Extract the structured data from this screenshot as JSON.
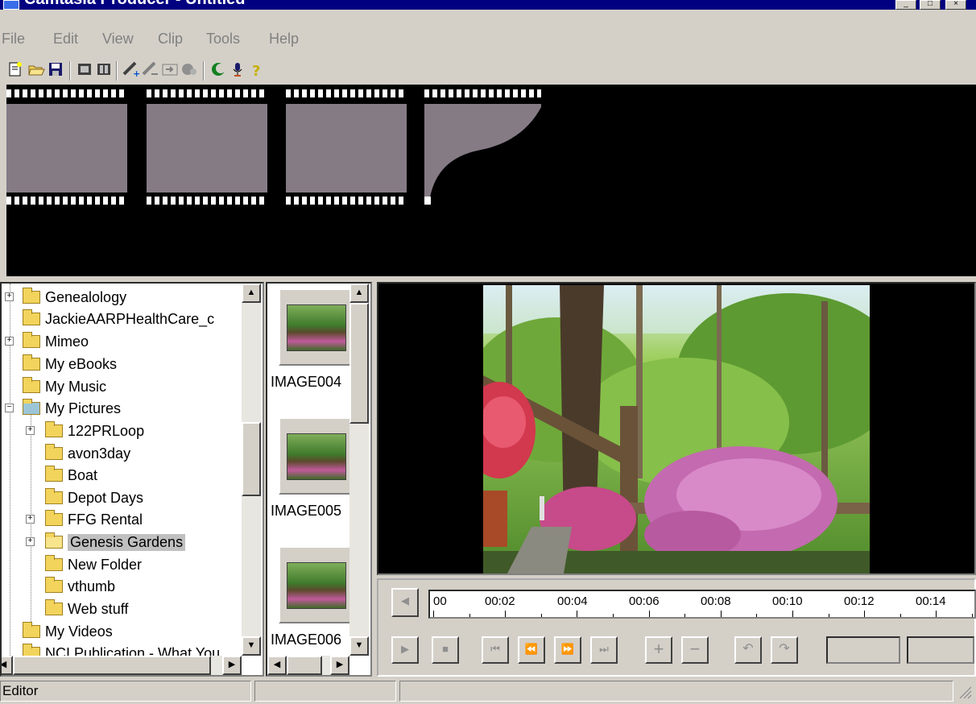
{
  "window": {
    "title": "Camtasia Producer - Untitled",
    "controls": [
      "_",
      "□",
      "×"
    ]
  },
  "menu": [
    {
      "label": "File"
    },
    {
      "label": "Edit"
    },
    {
      "label": "View"
    },
    {
      "label": "Clip"
    },
    {
      "label": "Tools"
    },
    {
      "label": "Help"
    }
  ],
  "toolbar": {
    "icons": [
      "new-file-icon",
      "open-folder-icon",
      "save-icon",
      "storyboard-icon",
      "timeline-icon",
      "add-clip-icon",
      "transition-icon",
      "title-clip-icon",
      "effects-icon",
      "record-icon",
      "microphone-icon",
      "help-icon"
    ]
  },
  "folder_tree": {
    "items": [
      {
        "label": "Genealology",
        "expander": "+"
      },
      {
        "label": "JackieAARPHealthCare_c"
      },
      {
        "label": "Mimeo",
        "expander": "+"
      },
      {
        "label": "My eBooks"
      },
      {
        "label": "My Music"
      },
      {
        "label": "My Pictures",
        "expander": "−"
      },
      {
        "label": "122PRLoop",
        "expander": "+"
      },
      {
        "label": "avon3day"
      },
      {
        "label": "Boat"
      },
      {
        "label": "Depot Days"
      },
      {
        "label": "FFG Rental",
        "expander": "+"
      },
      {
        "label": "Genesis Gardens",
        "expander": "+",
        "selected": true
      },
      {
        "label": "New Folder"
      },
      {
        "label": "vthumb"
      },
      {
        "label": "Web stuff"
      },
      {
        "label": "My Videos"
      },
      {
        "label": "NCI Publication - What You"
      }
    ]
  },
  "thumbnails": [
    {
      "label": "IMAGE004"
    },
    {
      "label": "IMAGE005"
    },
    {
      "label": "IMAGE006"
    }
  ],
  "timeline": {
    "ticks": [
      "00",
      "00:02",
      "00:04",
      "00:06",
      "00:08",
      "00:10",
      "00:12",
      "00:14"
    ]
  },
  "playback": {
    "buttons": [
      "play-icon",
      "stop-icon",
      "go-to-start-icon",
      "rewind-icon",
      "fast-forward-icon",
      "go-to-end-icon",
      "zoom-in-icon",
      "zoom-out-icon",
      "undo-icon",
      "redo-icon"
    ],
    "play": "▶",
    "stop": "■",
    "start": "⏮",
    "rew": "⏪",
    "ff": "⏩",
    "end": "⏭",
    "plus": "+",
    "minus": "−",
    "undo": "↶",
    "redo": "↷"
  },
  "statusbar": {
    "mode": "Editor"
  },
  "colors": {
    "chrome": "#d4d0c8",
    "storyboard_bg": "#000000",
    "film_frame": "#857b85",
    "selection": "#c0c0c0"
  }
}
